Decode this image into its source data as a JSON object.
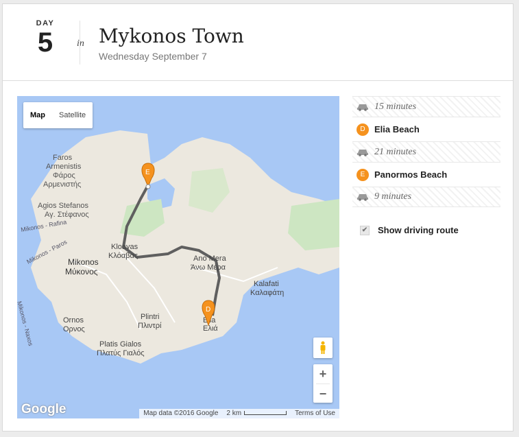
{
  "header": {
    "day_label": "DAY",
    "day_number": "5",
    "in_label": "in",
    "title": "Mykonos Town",
    "date": "Wednesday September 7"
  },
  "map": {
    "type_control": {
      "map": "Map",
      "satellite": "Satellite",
      "selected": "Map"
    },
    "labels": {
      "faros": "Faros",
      "armenistis": "Armenistis",
      "faros_gr": "Φάρος",
      "armenistis_gr": "Αρμενιστής",
      "agios_stefanos": "Agios Stefanos",
      "agios_stefanos_gr": "Αγ. Στέφανος",
      "route_rafina": "Mikonos - Rafina",
      "route_paros": "Mikonos - Paros",
      "route_naxos": "Mikonos - Naxos",
      "kloavas": "Kloavas",
      "kloavas_gr": "Κλόαβας",
      "mikonos": "Mikonos",
      "mikonos_gr": "Μύκονος",
      "ano_mera": "Ano Mera",
      "ano_mera_gr": "Άνω Μέρα",
      "kalafati": "Kalafati",
      "kalafati_gr": "Καλαφάτη",
      "ornos": "Ornos",
      "ornos_gr": "Ορνος",
      "plintri": "Plintri",
      "plintri_gr": "Πλιντρί",
      "elia": "Elia",
      "elia_gr": "Ελιά",
      "platis_gialos": "Platis Gialos",
      "platis_gialos_gr": "Πλατύς Γιαλός"
    },
    "markers": {
      "panormos": "E",
      "elia": "D"
    },
    "google_logo": "Google",
    "attribution": {
      "map_data": "Map data ©2016 Google",
      "scale": "2 km",
      "terms": "Terms of Use"
    },
    "zoom": {
      "in": "+",
      "out": "−"
    }
  },
  "itinerary": [
    {
      "kind": "drive",
      "icon": "car-icon",
      "text": "15 minutes"
    },
    {
      "kind": "stop",
      "badge": "D",
      "text": "Elia Beach"
    },
    {
      "kind": "drive",
      "icon": "car-icon",
      "text": "21 minutes"
    },
    {
      "kind": "stop",
      "badge": "E",
      "text": "Panormos Beach"
    },
    {
      "kind": "drive",
      "icon": "car-icon",
      "text": "9 minutes"
    }
  ],
  "route_toggle": {
    "label": "Show driving route",
    "checked": true,
    "check_glyph": "✔"
  },
  "colors": {
    "marker": "#f5921e",
    "route": "#5f5f5f",
    "water": "#a8c8f5",
    "land": "#ece8df",
    "park": "#cde6c2"
  }
}
